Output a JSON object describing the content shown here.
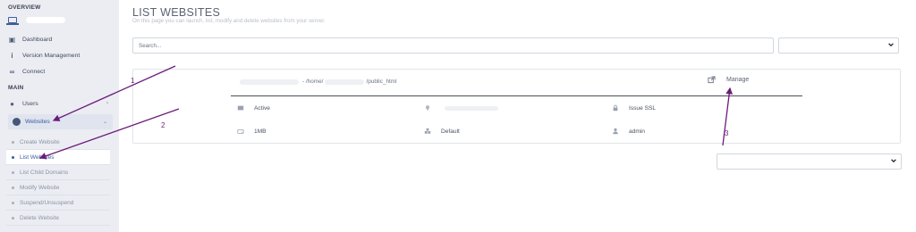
{
  "sidebar": {
    "overview_label": "OVERVIEW",
    "items_overview": [
      {
        "label": "Dashboard",
        "icon": "dashboard-icon"
      },
      {
        "label": "Version Management",
        "icon": "info-icon"
      },
      {
        "label": "Connect",
        "icon": "link-icon"
      }
    ],
    "main_label": "MAIN",
    "users_label": "Users",
    "websites_label": "Websites",
    "sub_items": [
      {
        "label": "Create Website"
      },
      {
        "label": "List Websites"
      },
      {
        "label": "List Child Domains"
      },
      {
        "label": "Modify Website"
      },
      {
        "label": "Suspend/Unsuspend"
      },
      {
        "label": "Delete Website"
      }
    ]
  },
  "page": {
    "title": "LIST WEBSITES",
    "subtitle": "On this page you can launch, list, modify and delete websites from your server.",
    "search_placeholder": "Search..."
  },
  "card": {
    "path_prefix": "- /home/",
    "path_suffix": "/public_html",
    "manage_label": "Manage",
    "status": "Active",
    "ssl_label": "Issue SSL",
    "disk": "1MB",
    "package": "Default",
    "owner": "admin"
  },
  "annotations": {
    "n1": "1",
    "n2": "2",
    "n3": "3",
    "color": "#6a1b7a"
  }
}
